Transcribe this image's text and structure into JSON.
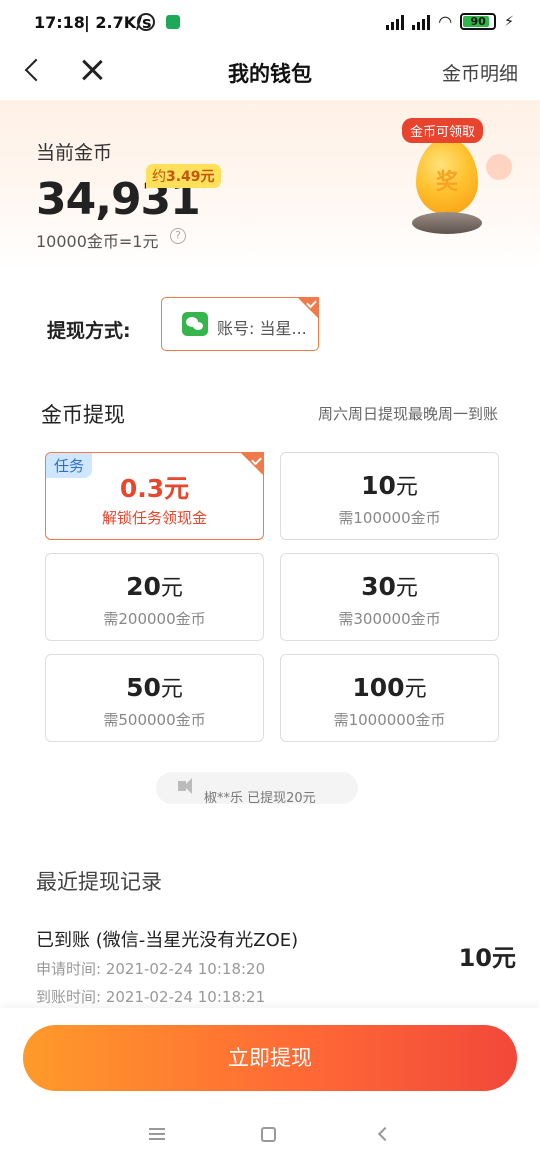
{
  "status_bar": {
    "time": "17:18",
    "net_speed": "| 2.7K/s",
    "battery": "90",
    "icons": [
      "alarm-icon",
      "app-notification-icon",
      "hd-signal-icon",
      "signal-icon",
      "wifi-icon",
      "battery-icon",
      "charging-icon"
    ]
  },
  "nav": {
    "title": "我的钱包",
    "detail_link": "金币明细",
    "icons": [
      "back-icon",
      "close-icon"
    ]
  },
  "balance": {
    "label": "当前金币",
    "amount": "34,931",
    "approx_prefix": "约",
    "approx_value": "3.49元",
    "rate": "10000金币=1元",
    "help_glyph": "?",
    "egg_tag": "金币可领取",
    "egg_glyph": "奖"
  },
  "method": {
    "label": "提现方式:",
    "account": "账号: 当星..."
  },
  "coin_withdraw": {
    "title": "金币提现",
    "note": "周六周日提现最晚周一到账",
    "options": [
      {
        "value": "0.3元",
        "unit": "",
        "requirement": "解锁任务领现金",
        "badge": "任务",
        "selected": true
      },
      {
        "value": "10",
        "unit": "元",
        "requirement": "需100000金币"
      },
      {
        "value": "20",
        "unit": "元",
        "requirement": "需200000金币"
      },
      {
        "value": "30",
        "unit": "元",
        "requirement": "需300000金币"
      },
      {
        "value": "50",
        "unit": "元",
        "requirement": "需500000金币"
      },
      {
        "value": "100",
        "unit": "元",
        "requirement": "需1000000金币"
      }
    ]
  },
  "ticker": {
    "text": "椒**乐 已提现20元"
  },
  "records": {
    "title": "最近提现记录",
    "items": [
      {
        "status": "已到账 (微信-当星光没有光ZOE)",
        "apply_time": "申请时间:  2021-02-24 10:18:20",
        "arrive_time": "到账时间:  2021-02-24 10:18:21",
        "amount": "10元"
      }
    ]
  },
  "cta": {
    "label": "立即提现"
  },
  "colors": {
    "accent": "#f07a4a",
    "cta_start": "#ff9a2a",
    "cta_end": "#f2483a",
    "highlight_red": "#e8472d",
    "wechat_green": "#35b54b"
  }
}
